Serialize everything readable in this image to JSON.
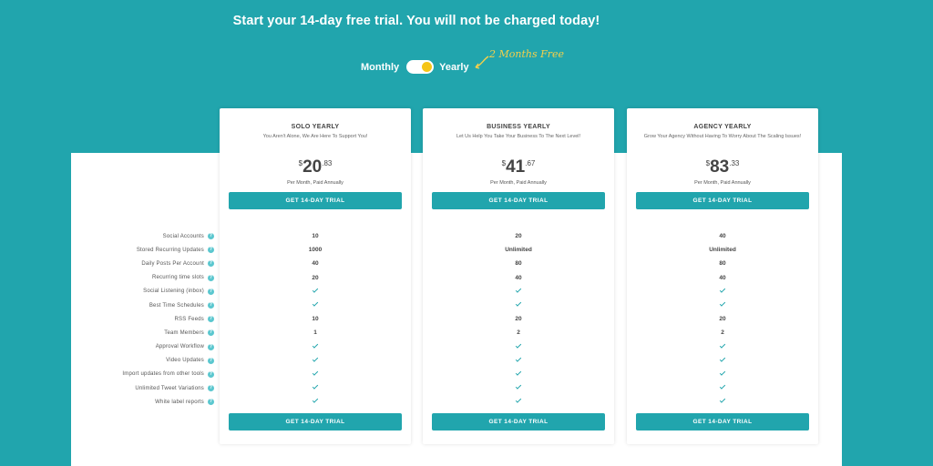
{
  "headline": "Start your 14-day free trial. You will not be charged today!",
  "billing": {
    "monthly_label": "Monthly",
    "yearly_label": "Yearly",
    "selected": "Yearly",
    "promo": "2 Months Free"
  },
  "features": [
    "Social Accounts",
    "Stored Recurring Updates",
    "Daily Posts Per Account",
    "Recurring time slots",
    "Social Listening (inbox)",
    "Best Time Schedules",
    "RSS Feeds",
    "Team Members",
    "Approval Workflow",
    "Video Updates",
    "Import updates from other tools",
    "Unlimited Tweet Variations",
    "White label reports"
  ],
  "help_glyph": "?",
  "plans": [
    {
      "title": "SOLO YEARLY",
      "subtitle": "You Aren't Alone, We Are Here To Support You!",
      "currency": "$",
      "price_int": "20",
      "price_cents": ".83",
      "billing_note": "Per Month, Paid Annually",
      "cta": "GET 14-DAY TRIAL",
      "values": [
        "10",
        "1000",
        "40",
        "20",
        "check",
        "check",
        "10",
        "1",
        "check",
        "check",
        "check",
        "check",
        "check"
      ]
    },
    {
      "title": "BUSINESS YEARLY",
      "subtitle": "Let Us Help You Take Your Business To The Next Level!",
      "currency": "$",
      "price_int": "41",
      "price_cents": ".67",
      "billing_note": "Per Month, Paid Annually",
      "cta": "GET 14-DAY TRIAL",
      "values": [
        "20",
        "Unlimited",
        "80",
        "40",
        "check",
        "check",
        "20",
        "2",
        "check",
        "check",
        "check",
        "check",
        "check"
      ]
    },
    {
      "title": "AGENCY YEARLY",
      "subtitle": "Grow Your Agency Without Having To Worry About The Scaling Issues!",
      "currency": "$",
      "price_int": "83",
      "price_cents": ".33",
      "billing_note": "Per Month, Paid Annually",
      "cta": "GET 14-DAY TRIAL",
      "values": [
        "40",
        "Unlimited",
        "80",
        "40",
        "check",
        "check",
        "20",
        "2",
        "check",
        "check",
        "check",
        "check",
        "check"
      ]
    }
  ],
  "colors": {
    "teal": "#21a5ad",
    "toggle_knob": "#f5c518",
    "promo": "#f5d04a"
  }
}
